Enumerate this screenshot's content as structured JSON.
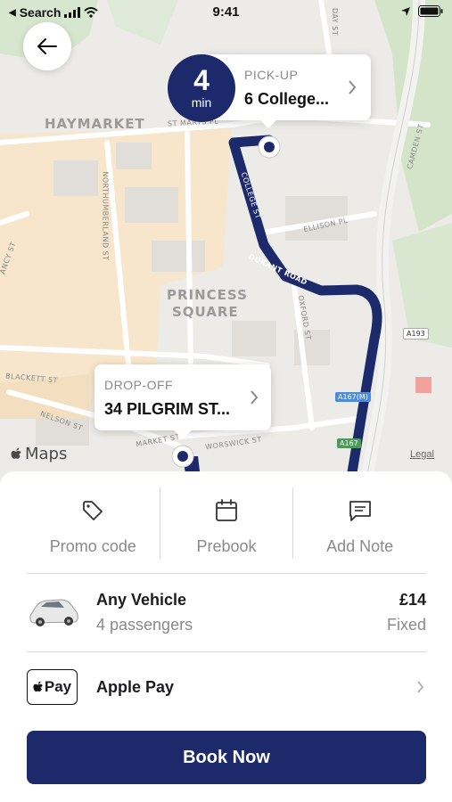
{
  "status_bar": {
    "back_app": "Search",
    "time": "9:41"
  },
  "map": {
    "districts": [
      "HAYMARKET",
      "PRINCESS",
      "SQUARE"
    ],
    "streets": [
      "ST MARYS PL",
      "NORTHUMBERLAND ST",
      "COLLEGE ST",
      "ELLISON PL",
      "DURANT ROAD",
      "OXFORD ST",
      "BLACKETT ST",
      "NELSON ST",
      "MARKET ST",
      "WORSWICK ST",
      "CAMDEN ST",
      "DAY ST",
      "ANCY ST"
    ],
    "shields": [
      "A193",
      "A167(M)",
      "A167"
    ],
    "maps_logo": "Maps",
    "legal": "Legal",
    "route_color": "#1c2a6b"
  },
  "eta": {
    "value": "4",
    "unit": "min"
  },
  "pickup": {
    "caption": "PICK-UP",
    "address": "6 College..."
  },
  "dropoff": {
    "caption": "DROP-OFF",
    "address": "34 PILGRIM ST..."
  },
  "actions": [
    {
      "label": "Promo code",
      "icon": "tag-icon"
    },
    {
      "label": "Prebook",
      "icon": "calendar-icon"
    },
    {
      "label": "Add Note",
      "icon": "note-icon"
    }
  ],
  "vehicle": {
    "name": "Any Vehicle",
    "passengers": "4 passengers",
    "price": "£14",
    "fare_type": "Fixed"
  },
  "payment": {
    "badge": "Pay",
    "label": "Apple Pay"
  },
  "book_button": "Book Now",
  "colors": {
    "brand_navy": "#1c2a6b",
    "secondary_text": "#8a8a8e"
  }
}
